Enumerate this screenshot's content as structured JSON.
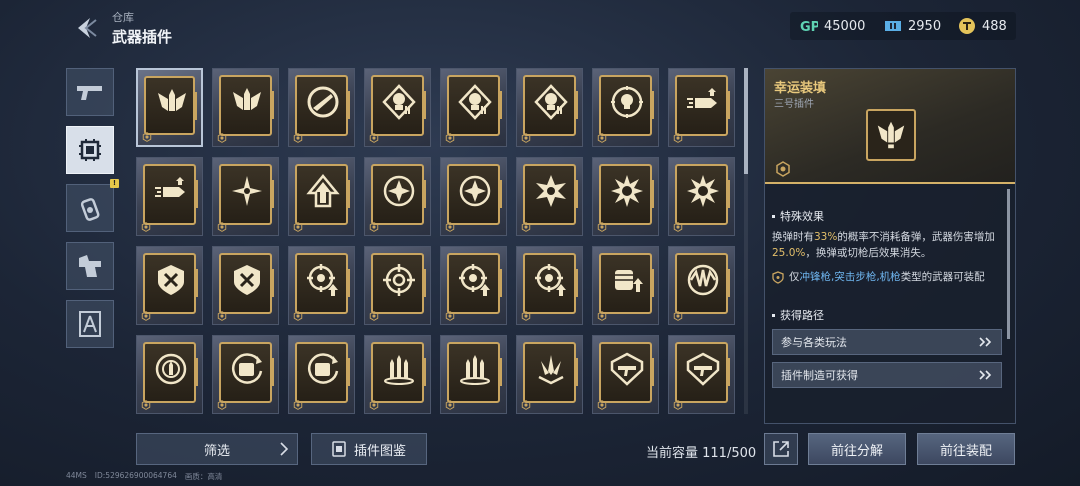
{
  "header": {
    "breadcrumb": "仓库",
    "title": "武器插件"
  },
  "currencies": [
    {
      "icon": "gp-icon",
      "value": "45000"
    },
    {
      "icon": "ticket-icon",
      "value": "2950"
    },
    {
      "icon": "coin-icon",
      "value": "488"
    }
  ],
  "side_tabs": [
    {
      "name": "pistol-icon",
      "active": false
    },
    {
      "name": "chip-plugin-icon",
      "active": true
    },
    {
      "name": "grenade-icon",
      "active": false,
      "badge": "!"
    },
    {
      "name": "armor-icon",
      "active": false
    },
    {
      "name": "character-icon",
      "active": false
    }
  ],
  "grid_items": [
    "bullet-wings-icon",
    "bullet-wings-icon",
    "rifle-circle-icon",
    "skull-ammo-icon",
    "skull-ammo-icon",
    "skull-ammo-icon",
    "skull-target-icon",
    "bullet-speed-icon",
    "bullet-speed-icon",
    "star-compass-icon",
    "arrow-up-icon",
    "star-crosshair-icon",
    "star-crosshair-icon",
    "burst-crosshair-icon",
    "explosion-icon",
    "explosion-icon",
    "shield-cross-icon",
    "shield-cross-icon",
    "crosshair-up-icon",
    "crosshair-icon",
    "crosshair-up-icon",
    "crosshair-up-icon",
    "fist-up-icon",
    "wave-emblem-icon",
    "target-bullet-icon",
    "fist-circle-icon",
    "fist-circle-icon",
    "ammo-stack-icon",
    "ammo-stack-icon",
    "spike-burst-icon",
    "gun-shield-icon",
    "gun-shield-icon"
  ],
  "bottom_bar": {
    "filter_label": "筛选",
    "catalog_label": "插件图鉴",
    "capacity_label": "当前容量 111/500"
  },
  "footer": {
    "latency": "44MS",
    "user_id": "ID:529626900064764",
    "quality": "画质：高清"
  },
  "detail": {
    "name": "幸运装填",
    "subtitle": "三号插件",
    "effect_title": "特殊效果",
    "effect_p1": "换弹时有",
    "effect_hl1": "33%",
    "effect_p2": "的概率不消耗备弹，武器伤害增加",
    "effect_hl2": "25.0%",
    "effect_p3": "，换弹或切枪后效果消失。",
    "restrict_prefix": "仅",
    "restrict_weapons": "冲锋枪,突击步枪,机枪",
    "restrict_suffix": "类型的武器可装配",
    "source_title": "获得路径",
    "sources": [
      "参与各类玩法",
      "插件制造可获得"
    ]
  },
  "actions": {
    "dismantle": "前往分解",
    "equip": "前往装配"
  }
}
